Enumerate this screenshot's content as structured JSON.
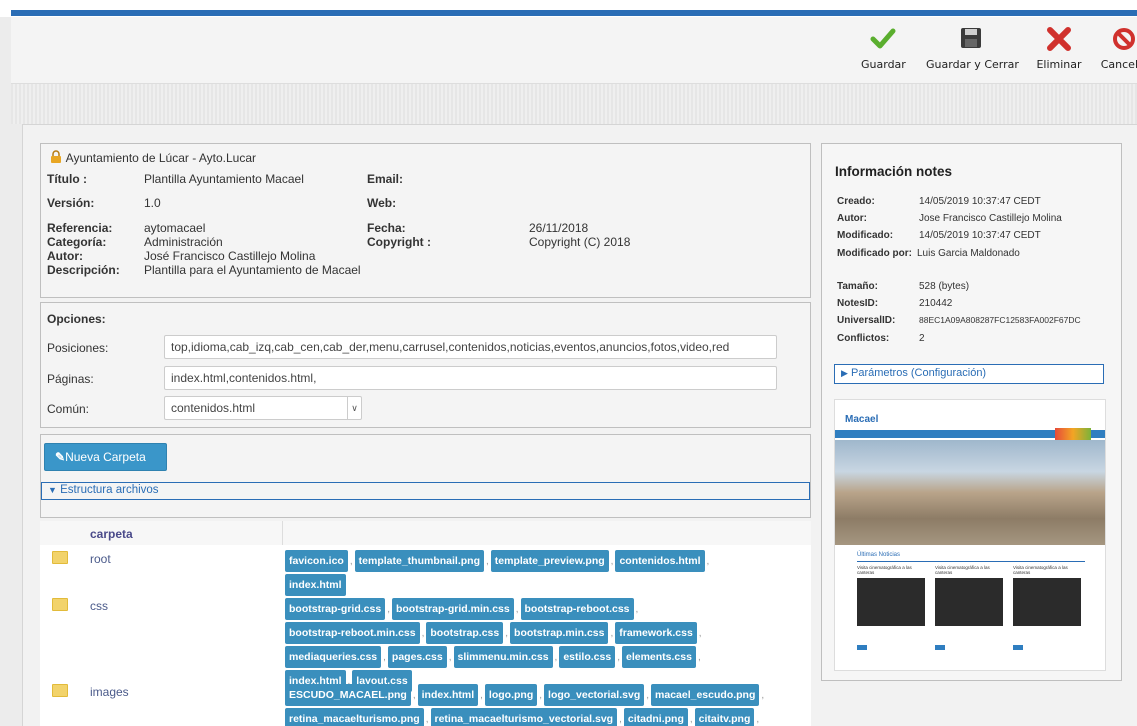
{
  "toolbar": {
    "save": "Guardar",
    "save_close": "Guardar y Cerrar",
    "delete": "Eliminar",
    "cancel": "Cancelar"
  },
  "template_info": {
    "owner": "Ayuntamiento de Lúcar - Ayto.Lucar",
    "titulo_label": "Título :",
    "titulo": "Plantilla Ayuntamiento Macael",
    "email_label": "Email:",
    "version_label": "Versión:",
    "version": "1.0",
    "web_label": "Web:",
    "referencia_label": "Referencia:",
    "referencia": "aytomacael",
    "fecha_label": "Fecha:",
    "fecha": "26/11/2018",
    "categoria_label": "Categoría:",
    "categoria": "Administración",
    "copyright_label": "Copyright :",
    "copyright": "Copyright (C) 2018",
    "autor_label": "Autor:",
    "autor": "José Francisco Castillejo Molina",
    "descripcion_label": "Descripción:",
    "descripcion": "Plantilla para el Ayuntamiento de Macael"
  },
  "options": {
    "title": "Opciones:",
    "posiciones_label": "Posiciones:",
    "posiciones": "top,idioma,cab_izq,cab_cen,cab_der,menu,carrusel,contenidos,noticias,eventos,anuncios,fotos,video,red",
    "paginas_label": "Páginas:",
    "paginas": "index.html,contenidos.html,",
    "comun_label": "Común:",
    "comun": "contenidos.html"
  },
  "new_folder_button": "Nueva Carpeta",
  "files": {
    "section_label": "Estructura archivos",
    "column_header": "carpeta",
    "folders": [
      {
        "name": "root",
        "files": [
          "favicon.ico",
          "template_thumbnail.png",
          "template_preview.png",
          "contenidos.html",
          "index.html"
        ]
      },
      {
        "name": "css",
        "files": [
          "bootstrap-grid.css",
          "bootstrap-grid.min.css",
          "bootstrap-reboot.css",
          "bootstrap-reboot.min.css",
          "bootstrap.css",
          "bootstrap.min.css",
          "framework.css",
          "mediaqueries.css",
          "pages.css",
          "slimmenu.min.css",
          "estilo.css",
          "elements.css",
          "index.html",
          "layout.css"
        ]
      },
      {
        "name": "images",
        "files": [
          "ESCUDO_MACAEL.png",
          "index.html",
          "logo.png",
          "logo_vectorial.svg",
          "macael_escudo.png",
          "retina_macaelturismo.png",
          "retina_macaelturismo_vectorial.svg",
          "citadni.png",
          "citaitv.png"
        ]
      }
    ]
  },
  "notes": {
    "title": "Información notes",
    "rows": [
      {
        "k": "Creado:",
        "v": "14/05/2019 10:37:47 CEDT"
      },
      {
        "k": "Autor:",
        "v": "Jose Francisco Castillejo Molina"
      },
      {
        "k": "Modificado:",
        "v": "14/05/2019 10:37:47 CEDT"
      },
      {
        "k": "Modificado por:",
        "v": "Luis Garcia Maldonado"
      },
      {
        "k": "Tamaño:",
        "v": "528 (bytes)"
      },
      {
        "k": "NotesID:",
        "v": "210442"
      },
      {
        "k": "UniversalID:",
        "v": "88EC1A09A808287FC12583FA002F67DC"
      },
      {
        "k": "Conflictos:",
        "v": "2"
      }
    ],
    "params_label": "Parámetros (Configuración)"
  },
  "preview": {
    "brand": "Macael",
    "section": "Últimas Noticias",
    "news_caption": "Visita cinematográfica a las canteras"
  },
  "colors": {
    "accent": "#2a6db5",
    "tag": "#3a8fbd",
    "button": "#3a96c9"
  }
}
